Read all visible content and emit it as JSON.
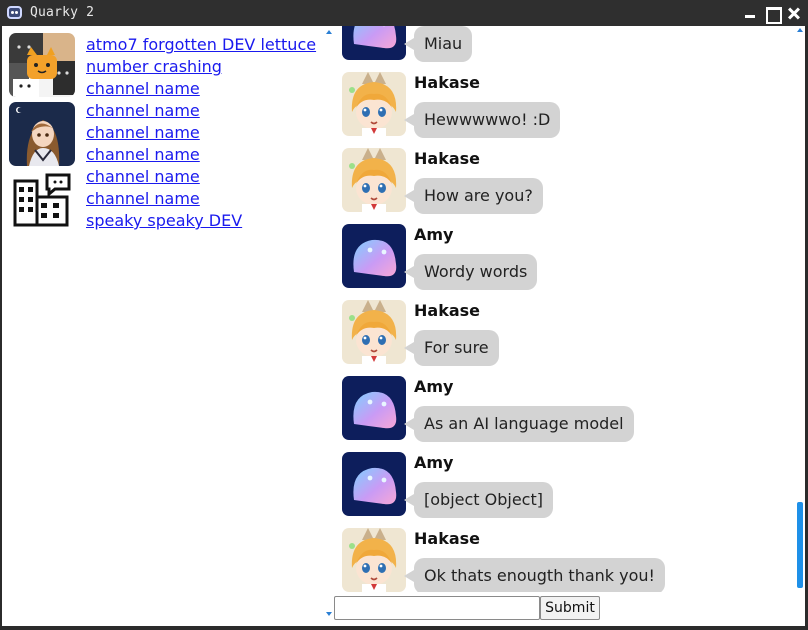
{
  "window": {
    "title": "Quarky 2",
    "icon": "robot-app-icon"
  },
  "servers": [
    {
      "name": "cats-server-icon",
      "icon": "cats-avatar"
    },
    {
      "name": "anime-girl-server-icon",
      "icon": "anime-girl-avatar"
    },
    {
      "name": "building-chat-server-icon",
      "icon": "building-chat-avatar"
    }
  ],
  "channels": [
    {
      "label": "atmo7 forgotten DEV lettuce"
    },
    {
      "label": "number crashing"
    },
    {
      "label": "channel name"
    },
    {
      "label": "channel name"
    },
    {
      "label": "channel name"
    },
    {
      "label": "channel name"
    },
    {
      "label": "channel name"
    },
    {
      "label": "channel name"
    },
    {
      "label": "speaky speaky DEV"
    }
  ],
  "messages": [
    {
      "author": "",
      "text": "Miau",
      "avatar": "amy-blob-avatar"
    },
    {
      "author": "Hakase",
      "text": "Hewwwwwo! :D",
      "avatar": "hakase-avatar"
    },
    {
      "author": "Hakase",
      "text": "How are you?",
      "avatar": "hakase-avatar"
    },
    {
      "author": "Amy",
      "text": "Wordy words",
      "avatar": "amy-blob-avatar"
    },
    {
      "author": "Hakase",
      "text": "For sure",
      "avatar": "hakase-avatar"
    },
    {
      "author": "Amy",
      "text": "As an AI language model",
      "avatar": "amy-blob-avatar"
    },
    {
      "author": "Amy",
      "text": "[object Object]",
      "avatar": "amy-blob-avatar"
    },
    {
      "author": "Hakase",
      "text": "Ok thats enougth thank you!",
      "avatar": "hakase-avatar"
    }
  ],
  "composer": {
    "value": "",
    "placeholder": "",
    "submit_label": "Submit"
  },
  "colors": {
    "link": "#1a1aee",
    "bubble": "#d3d3d3",
    "accent": "#1e90e8",
    "amy_bg": "#0d1e5c"
  }
}
